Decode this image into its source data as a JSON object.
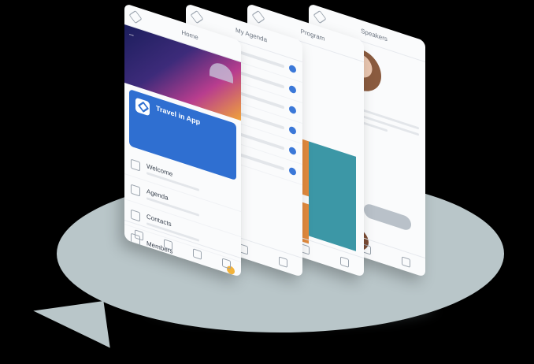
{
  "screens": {
    "home": {
      "title": "Home",
      "banner_text": "...",
      "hero_label": "Travel in App",
      "menu": [
        "Welcome",
        "Agenda",
        "Contacts",
        "Members"
      ]
    },
    "agenda": {
      "title": "My Agenda"
    },
    "schedule": {
      "title": "Program",
      "panel_label": ""
    },
    "speaker": {
      "title": "Speakers",
      "name": "..."
    }
  },
  "colors": {
    "primary": "#2f6fd1",
    "accent_orange": "#e28a3d",
    "accent_teal": "#3c97a6",
    "bubble": "#b9c6c9",
    "background": "#000000"
  }
}
